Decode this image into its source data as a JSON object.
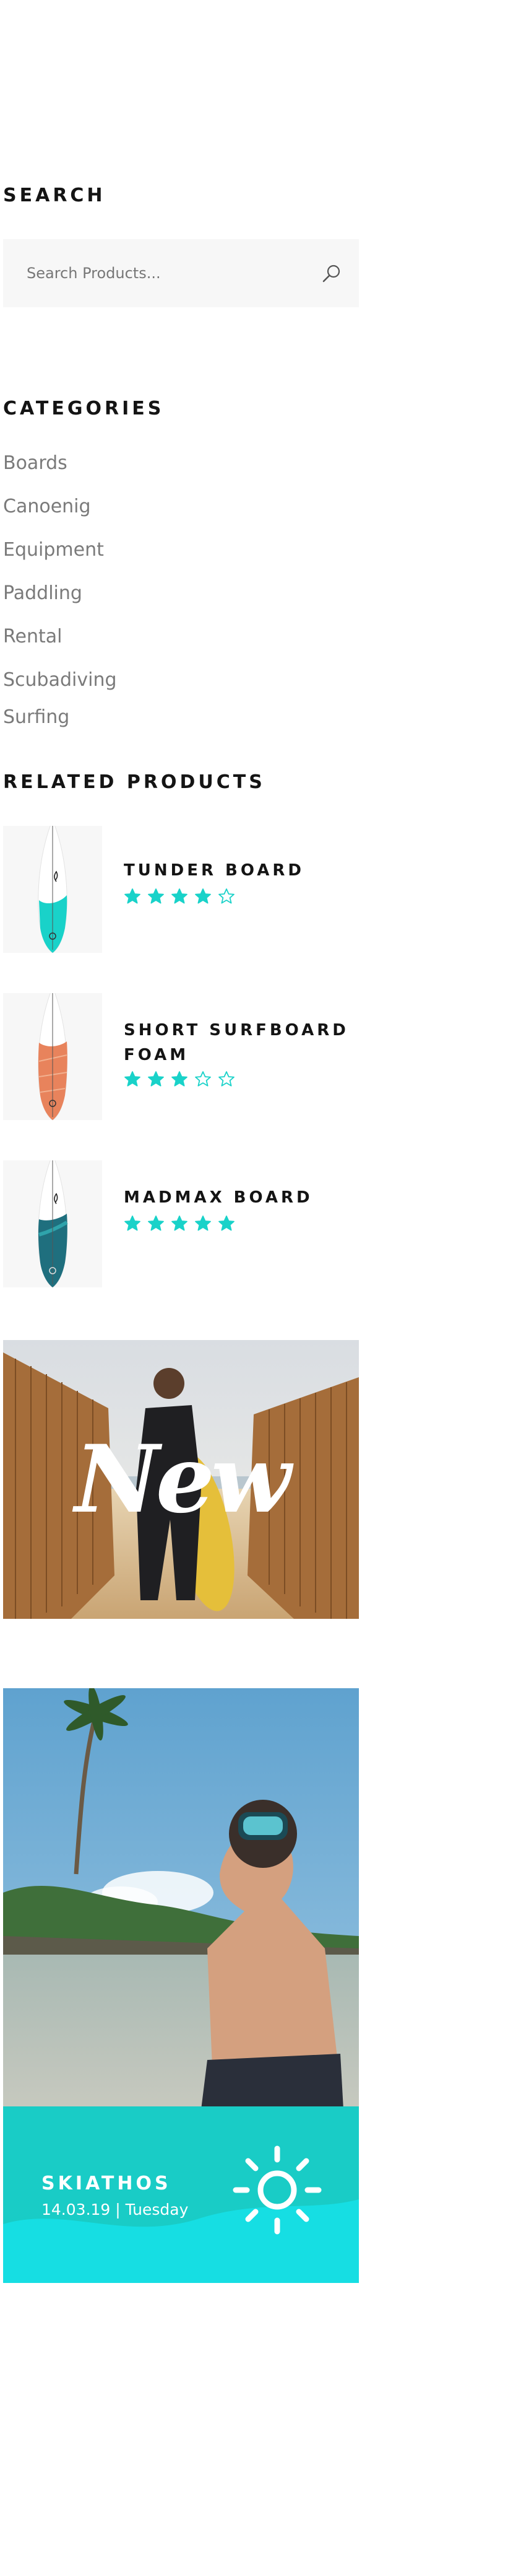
{
  "search": {
    "title": "SEARCH",
    "placeholder": "Search Products..."
  },
  "categories": {
    "title": "CATEGORIES",
    "items": [
      "Boards",
      "Canoenig",
      "Equipment",
      "Paddling",
      "Rental",
      "Scubadiving",
      "Surfing"
    ]
  },
  "related": {
    "title": "RELATED PRODUCTS",
    "products": [
      {
        "name": "TUNDER BOARD",
        "rating": 4,
        "max_rating": 5,
        "board_color": "#19d2c9"
      },
      {
        "name": "SHORT SURFBOARD FOAM",
        "rating": 3,
        "max_rating": 5,
        "board_color": "#e8835c"
      },
      {
        "name": "MADMAX BOARD",
        "rating": 5,
        "max_rating": 5,
        "board_color": "#1f6f7e"
      }
    ]
  },
  "banner_new": {
    "overlay_text": "New"
  },
  "weather": {
    "city": "SKIATHOS",
    "date": "14.03.19",
    "day": "Tuesday",
    "separator": "|",
    "icon": "sun-icon"
  },
  "colors": {
    "accent": "#19d2c9",
    "title": "#141414",
    "muted": "#7a7a7a",
    "box_bg": "#f7f7f7"
  }
}
